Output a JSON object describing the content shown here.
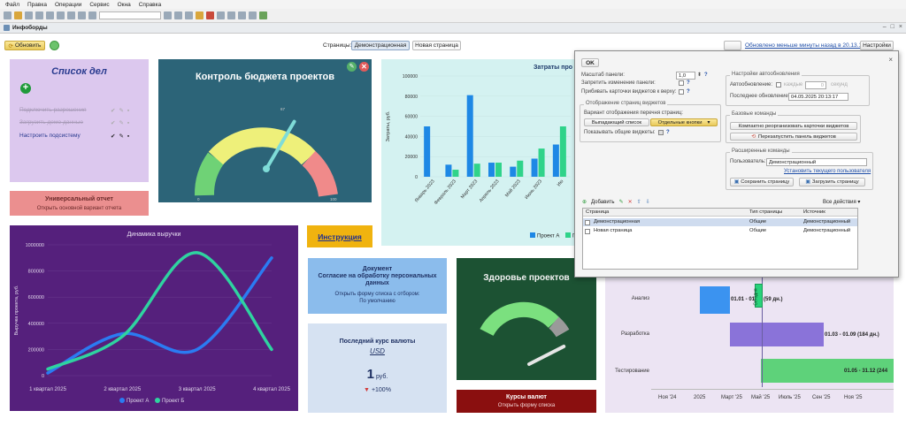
{
  "menu": [
    "Файл",
    "Правка",
    "Операции",
    "Сервис",
    "Окна",
    "Справка"
  ],
  "window_title": "Инфоборды",
  "cmd": {
    "refresh": "Обновить",
    "pages_label": "Страницы:",
    "tabs": [
      "Демонстрационная",
      "Новая страница"
    ],
    "updated": "Обновлено меньше минуты назад в 20.13.17",
    "settings": "Настройки"
  },
  "todo": {
    "title": "Список дел",
    "items": [
      "Подключить разрешения",
      "Загрузить демо-данные",
      "Настроить подсистему"
    ]
  },
  "budget": {
    "title": "Контроль бюджета проектов",
    "ticks": [
      "0",
      "67",
      "100"
    ],
    "gauge_fraction": 0.67
  },
  "costs": {
    "title": "Затраты про",
    "ylabel": "Затраты, руб."
  },
  "report": {
    "title": "Универсальный отчет",
    "subtitle": "Открыть основной вариант отчета"
  },
  "revenue": {
    "title": "Динамика выручки",
    "ylabel": "Выручка проекта, руб."
  },
  "instruction": {
    "label": "Инструкция"
  },
  "consent": {
    "title": "Документ",
    "subtitle": "Согласие на обработку персональных данных",
    "line1": "Открыть форму списка с отбором:",
    "line2": "По умолчанию"
  },
  "rate": {
    "title": "Последний курс валюты",
    "currency": "USD",
    "value": "1",
    "unit": "руб.",
    "change": "+100%"
  },
  "health": {
    "title": "Здоровье проектов",
    "gauge_fraction": 0.85
  },
  "fx": {
    "title": "Курсы валют",
    "subtitle": "Открыть форму списка"
  },
  "gantt": {
    "rows": [
      {
        "name": "Анализ",
        "label": "01.01 - 01.03 (59 дн.)",
        "color": "#3b93f0"
      },
      {
        "name": "Разработка",
        "label": "01.03 - 01.09 (184 дн.)",
        "color": "#8a73d9"
      },
      {
        "name": "Тестирование",
        "label": "01.05 - 31.12 (244",
        "color": "#5ed27a"
      }
    ],
    "marker": "Сегодня",
    "xticks": [
      "Ноя '24",
      "2025",
      "Март '25",
      "Май '25",
      "Июль '25",
      "Сен '25",
      "Ноя '25"
    ]
  },
  "dialog": {
    "ok": "OK",
    "scale_label": "Масштаб панели:",
    "scale_value": "1,0",
    "lock_label": "Запретить изменение панели:",
    "stick_label": "Прибивать карточки виджетов к верху:",
    "display_group": "Отображение страниц виджетов",
    "variant_label": "Вариант отображения перечня страниц:",
    "variant_opt1": "Выпадающий список",
    "variant_opt2": "Отдельные кнопки",
    "common_label": "Показывать общие виджеты:",
    "auto_group": "Настройки автообновления",
    "auto_label": "Автообновление:",
    "each_label": "каждые",
    "each_value": "0",
    "sec_label": "секунд",
    "last_label": "Последнее обновление:",
    "last_value": "04.05.2025 20:13:17",
    "base_group": "Базовые команды",
    "cmd_compact": "Компактно реорганизовать карточки виджетов",
    "cmd_restart": "Перезапустить панель виджетов",
    "ext_group": "Расширенные команды",
    "user_label": "Пользователь:",
    "user_value": "Демонстрационный",
    "set_current": "Установить текущего пользователя",
    "save_page": "Сохранить страницу",
    "load_page": "Загрузить страницу",
    "add": "Добавить",
    "all_actions": "Все действия",
    "table_headers": [
      "Страница",
      "Тип страницы",
      "Источник"
    ],
    "table_rows": [
      [
        "Демонстрационная",
        "Общие",
        "Демонстрационный"
      ],
      [
        "Новая страница",
        "Общие",
        "Демонстрационный"
      ]
    ]
  },
  "chart_data": [
    {
      "type": "bar",
      "title": "Затраты про",
      "ylabel": "Затраты, руб.",
      "ylim": [
        0,
        100000
      ],
      "yticks": [
        "0",
        "20000",
        "40000",
        "60000",
        "80000",
        "100000"
      ],
      "categories": [
        "Январь 2023",
        "Февраль 2023",
        "Март 2023",
        "Апрель 2023",
        "Май 2023",
        "Июнь 2023",
        "Ию"
      ],
      "series": [
        {
          "name": "Проект А",
          "color": "#1e88e5",
          "values": [
            50000,
            12000,
            81000,
            14000,
            10000,
            18000,
            32000
          ]
        },
        {
          "name": "Проект Б",
          "color": "#2fd38a",
          "values": [
            0,
            7000,
            13000,
            14000,
            16000,
            28000,
            50000
          ]
        }
      ]
    },
    {
      "type": "line",
      "title": "Динамика выручки",
      "ylabel": "Выручка проекта, руб.",
      "ylim": [
        0,
        1000000
      ],
      "yticks": [
        "0",
        "200000",
        "400000",
        "600000",
        "800000",
        "1000000"
      ],
      "categories": [
        "1 квартал 2025",
        "2 квартал 2025",
        "3 квартал 2025",
        "4 квартал 2025"
      ],
      "series": [
        {
          "name": "Проект А",
          "color": "#2b7bf2",
          "values": [
            20000,
            320000,
            200000,
            900000
          ]
        },
        {
          "name": "Проект Б",
          "color": "#2fd3a0",
          "values": [
            50000,
            300000,
            940000,
            200000
          ]
        }
      ]
    }
  ]
}
